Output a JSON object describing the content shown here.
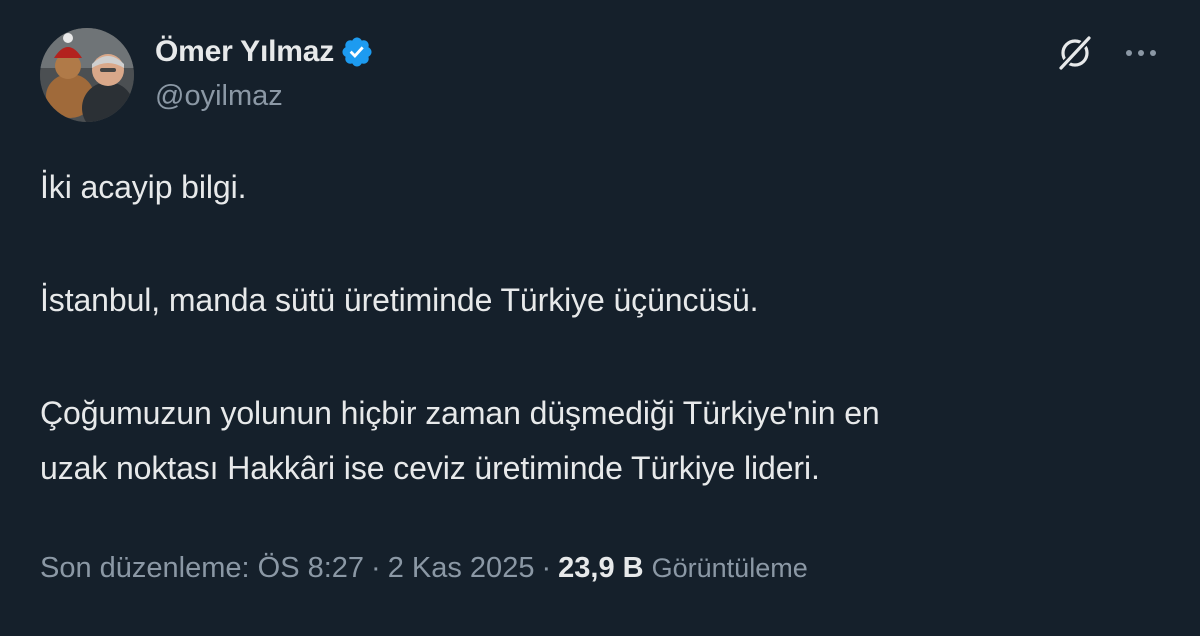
{
  "author": {
    "display_name": "Ömer Yılmaz",
    "handle": "@oyilmaz",
    "verified": true,
    "verified_color": "#1d9bf0"
  },
  "header_actions": {
    "grok_icon": "grok-icon",
    "more_icon": "more-icon"
  },
  "tweet": {
    "paragraphs": [
      "İki acayip bilgi.",
      "İstanbul, manda sütü üretiminde Türkiye üçüncüsü.",
      "Çoğumuzun yolunun hiçbir zaman düşmediği Türkiye'nin en\nuzak noktası Hakkâri ise ceviz üretiminde Türkiye lideri."
    ]
  },
  "meta": {
    "edited_label": "Son düzenleme: ÖS 8:27",
    "separator": "·",
    "date": "2 Kas 2025",
    "views_count": "23,9 B",
    "views_label": "Görüntüleme"
  },
  "colors": {
    "background": "#15202b",
    "primary_text": "#e7e9ea",
    "secondary_text": "#8b98a5",
    "accent": "#1d9bf0"
  }
}
